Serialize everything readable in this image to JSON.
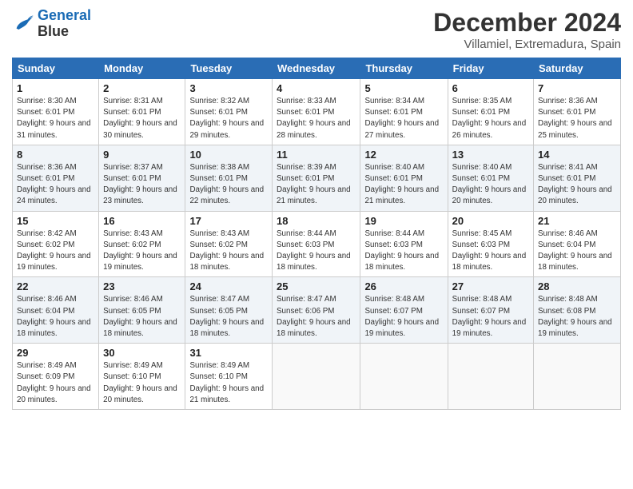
{
  "header": {
    "logo_line1": "General",
    "logo_line2": "Blue",
    "month": "December 2024",
    "location": "Villamiel, Extremadura, Spain"
  },
  "days_of_week": [
    "Sunday",
    "Monday",
    "Tuesday",
    "Wednesday",
    "Thursday",
    "Friday",
    "Saturday"
  ],
  "weeks": [
    [
      {
        "num": "1",
        "sunrise": "Sunrise: 8:30 AM",
        "sunset": "Sunset: 6:01 PM",
        "daylight": "Daylight: 9 hours and 31 minutes."
      },
      {
        "num": "2",
        "sunrise": "Sunrise: 8:31 AM",
        "sunset": "Sunset: 6:01 PM",
        "daylight": "Daylight: 9 hours and 30 minutes."
      },
      {
        "num": "3",
        "sunrise": "Sunrise: 8:32 AM",
        "sunset": "Sunset: 6:01 PM",
        "daylight": "Daylight: 9 hours and 29 minutes."
      },
      {
        "num": "4",
        "sunrise": "Sunrise: 8:33 AM",
        "sunset": "Sunset: 6:01 PM",
        "daylight": "Daylight: 9 hours and 28 minutes."
      },
      {
        "num": "5",
        "sunrise": "Sunrise: 8:34 AM",
        "sunset": "Sunset: 6:01 PM",
        "daylight": "Daylight: 9 hours and 27 minutes."
      },
      {
        "num": "6",
        "sunrise": "Sunrise: 8:35 AM",
        "sunset": "Sunset: 6:01 PM",
        "daylight": "Daylight: 9 hours and 26 minutes."
      },
      {
        "num": "7",
        "sunrise": "Sunrise: 8:36 AM",
        "sunset": "Sunset: 6:01 PM",
        "daylight": "Daylight: 9 hours and 25 minutes."
      }
    ],
    [
      {
        "num": "8",
        "sunrise": "Sunrise: 8:36 AM",
        "sunset": "Sunset: 6:01 PM",
        "daylight": "Daylight: 9 hours and 24 minutes."
      },
      {
        "num": "9",
        "sunrise": "Sunrise: 8:37 AM",
        "sunset": "Sunset: 6:01 PM",
        "daylight": "Daylight: 9 hours and 23 minutes."
      },
      {
        "num": "10",
        "sunrise": "Sunrise: 8:38 AM",
        "sunset": "Sunset: 6:01 PM",
        "daylight": "Daylight: 9 hours and 22 minutes."
      },
      {
        "num": "11",
        "sunrise": "Sunrise: 8:39 AM",
        "sunset": "Sunset: 6:01 PM",
        "daylight": "Daylight: 9 hours and 21 minutes."
      },
      {
        "num": "12",
        "sunrise": "Sunrise: 8:40 AM",
        "sunset": "Sunset: 6:01 PM",
        "daylight": "Daylight: 9 hours and 21 minutes."
      },
      {
        "num": "13",
        "sunrise": "Sunrise: 8:40 AM",
        "sunset": "Sunset: 6:01 PM",
        "daylight": "Daylight: 9 hours and 20 minutes."
      },
      {
        "num": "14",
        "sunrise": "Sunrise: 8:41 AM",
        "sunset": "Sunset: 6:01 PM",
        "daylight": "Daylight: 9 hours and 20 minutes."
      }
    ],
    [
      {
        "num": "15",
        "sunrise": "Sunrise: 8:42 AM",
        "sunset": "Sunset: 6:02 PM",
        "daylight": "Daylight: 9 hours and 19 minutes."
      },
      {
        "num": "16",
        "sunrise": "Sunrise: 8:43 AM",
        "sunset": "Sunset: 6:02 PM",
        "daylight": "Daylight: 9 hours and 19 minutes."
      },
      {
        "num": "17",
        "sunrise": "Sunrise: 8:43 AM",
        "sunset": "Sunset: 6:02 PM",
        "daylight": "Daylight: 9 hours and 18 minutes."
      },
      {
        "num": "18",
        "sunrise": "Sunrise: 8:44 AM",
        "sunset": "Sunset: 6:03 PM",
        "daylight": "Daylight: 9 hours and 18 minutes."
      },
      {
        "num": "19",
        "sunrise": "Sunrise: 8:44 AM",
        "sunset": "Sunset: 6:03 PM",
        "daylight": "Daylight: 9 hours and 18 minutes."
      },
      {
        "num": "20",
        "sunrise": "Sunrise: 8:45 AM",
        "sunset": "Sunset: 6:03 PM",
        "daylight": "Daylight: 9 hours and 18 minutes."
      },
      {
        "num": "21",
        "sunrise": "Sunrise: 8:46 AM",
        "sunset": "Sunset: 6:04 PM",
        "daylight": "Daylight: 9 hours and 18 minutes."
      }
    ],
    [
      {
        "num": "22",
        "sunrise": "Sunrise: 8:46 AM",
        "sunset": "Sunset: 6:04 PM",
        "daylight": "Daylight: 9 hours and 18 minutes."
      },
      {
        "num": "23",
        "sunrise": "Sunrise: 8:46 AM",
        "sunset": "Sunset: 6:05 PM",
        "daylight": "Daylight: 9 hours and 18 minutes."
      },
      {
        "num": "24",
        "sunrise": "Sunrise: 8:47 AM",
        "sunset": "Sunset: 6:05 PM",
        "daylight": "Daylight: 9 hours and 18 minutes."
      },
      {
        "num": "25",
        "sunrise": "Sunrise: 8:47 AM",
        "sunset": "Sunset: 6:06 PM",
        "daylight": "Daylight: 9 hours and 18 minutes."
      },
      {
        "num": "26",
        "sunrise": "Sunrise: 8:48 AM",
        "sunset": "Sunset: 6:07 PM",
        "daylight": "Daylight: 9 hours and 19 minutes."
      },
      {
        "num": "27",
        "sunrise": "Sunrise: 8:48 AM",
        "sunset": "Sunset: 6:07 PM",
        "daylight": "Daylight: 9 hours and 19 minutes."
      },
      {
        "num": "28",
        "sunrise": "Sunrise: 8:48 AM",
        "sunset": "Sunset: 6:08 PM",
        "daylight": "Daylight: 9 hours and 19 minutes."
      }
    ],
    [
      {
        "num": "29",
        "sunrise": "Sunrise: 8:49 AM",
        "sunset": "Sunset: 6:09 PM",
        "daylight": "Daylight: 9 hours and 20 minutes."
      },
      {
        "num": "30",
        "sunrise": "Sunrise: 8:49 AM",
        "sunset": "Sunset: 6:10 PM",
        "daylight": "Daylight: 9 hours and 20 minutes."
      },
      {
        "num": "31",
        "sunrise": "Sunrise: 8:49 AM",
        "sunset": "Sunset: 6:10 PM",
        "daylight": "Daylight: 9 hours and 21 minutes."
      },
      null,
      null,
      null,
      null
    ]
  ]
}
